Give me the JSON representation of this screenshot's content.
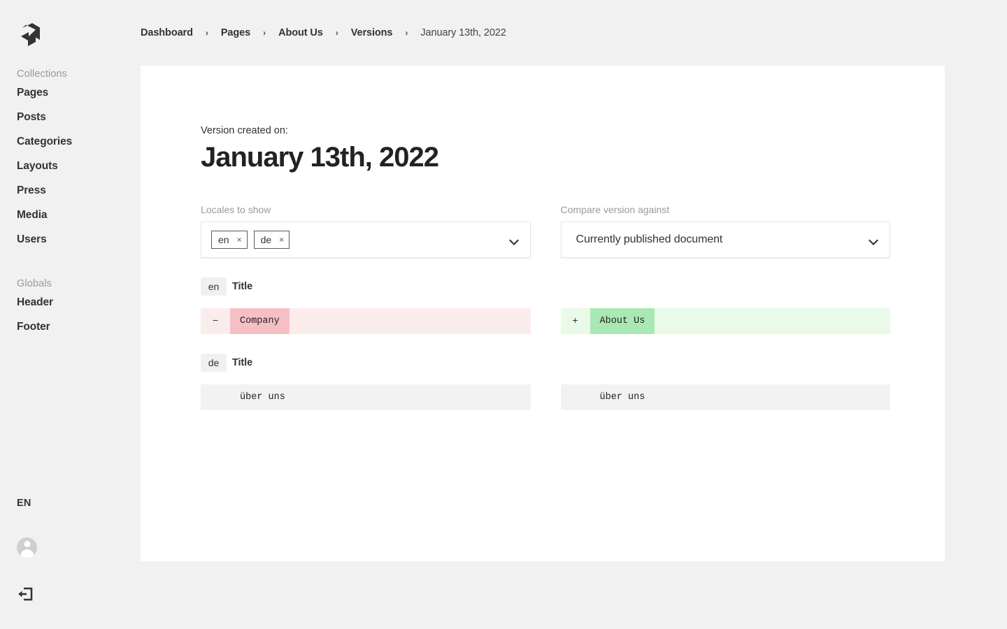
{
  "sidebar": {
    "logo_name": "payload-logo",
    "collections_label": "Collections",
    "collections": [
      {
        "label": "Pages"
      },
      {
        "label": "Posts"
      },
      {
        "label": "Categories"
      },
      {
        "label": "Layouts"
      },
      {
        "label": "Press"
      },
      {
        "label": "Media"
      },
      {
        "label": "Users"
      }
    ],
    "globals_label": "Globals",
    "globals": [
      {
        "label": "Header"
      },
      {
        "label": "Footer"
      }
    ],
    "language": "EN",
    "account_icon": "user-avatar-icon",
    "logout_icon": "logout-icon"
  },
  "breadcrumb": {
    "separator": "›",
    "items": [
      {
        "label": "Dashboard",
        "current": false
      },
      {
        "label": "Pages",
        "current": false
      },
      {
        "label": "About Us",
        "current": false
      },
      {
        "label": "Versions",
        "current": false
      },
      {
        "label": "January 13th, 2022",
        "current": true
      }
    ]
  },
  "main": {
    "eyebrow": "Version created on:",
    "title": "January 13th, 2022",
    "locales_field": {
      "label": "Locales to show",
      "tags": [
        {
          "value": "en",
          "remove": "×"
        },
        {
          "value": "de",
          "remove": "×"
        }
      ],
      "chevron_icon": "chevron-down-icon"
    },
    "compare_field": {
      "label": "Compare version against",
      "value": "Currently published document",
      "chevron_icon": "chevron-down-icon"
    },
    "diffs": [
      {
        "locale": "en",
        "field": "Title",
        "left": {
          "marker": "−",
          "text": "Company",
          "state": "removed"
        },
        "right": {
          "marker": "+",
          "text": "About Us",
          "state": "added"
        }
      },
      {
        "locale": "de",
        "field": "Title",
        "left": {
          "marker": "",
          "text": "über uns",
          "state": "same"
        },
        "right": {
          "marker": "",
          "text": "über uns",
          "state": "same"
        }
      }
    ]
  },
  "colors": {
    "background": "#f1f1f1",
    "panel": "#ffffff",
    "removed_bg": "#fbecec",
    "removed_highlight": "#f6bfc5",
    "added_bg": "#e9fae9",
    "added_highlight": "#a9e8b4",
    "unchanged_bg": "#f2f2f2",
    "text": "#333333",
    "muted_text": "#9a9a9a"
  }
}
